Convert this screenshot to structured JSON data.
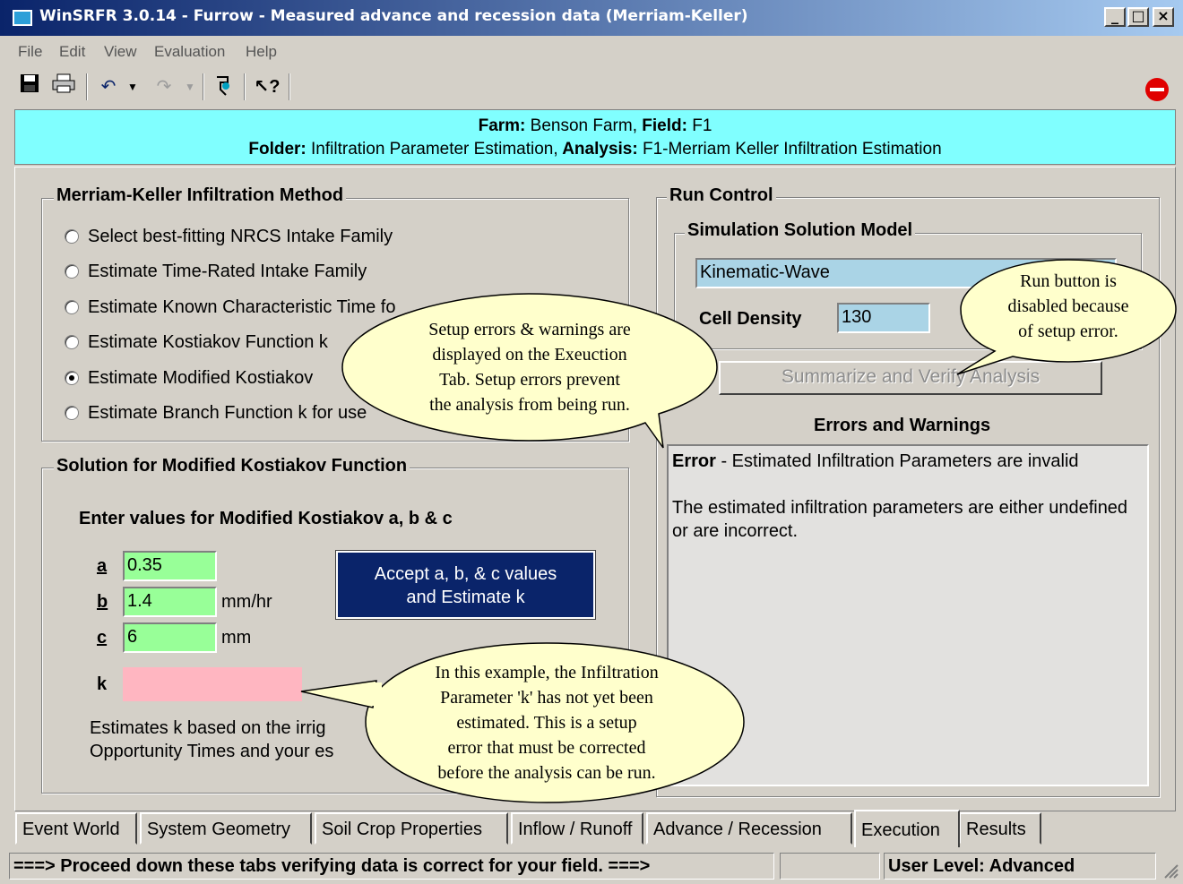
{
  "window": {
    "title": "WinSRFR 3.0.14 - Furrow - Measured advance and recession data (Merriam-Keller)",
    "min_label": "_",
    "max_label": "□",
    "close_label": "×"
  },
  "menu": [
    "File",
    "Edit",
    "View",
    "Evaluation",
    "Help"
  ],
  "toolbar": {
    "icons": [
      "save-icon",
      "print-icon",
      "undo-icon",
      "redo-icon",
      "tape-icon",
      "whats-this-icon",
      "stop-icon"
    ]
  },
  "header": {
    "farm_label": "Farm:",
    "farm_value": " Benson Farm,",
    "field_label": " Field:",
    "field_value": " F1",
    "folder_label": "Folder:",
    "folder_value": " Infiltration Parameter Estimation,",
    "analysis_label": " Analysis:",
    "analysis_value": " F1-Merriam Keller Infiltration Estimation"
  },
  "method": {
    "title": "Merriam-Keller Infiltration Method",
    "options": [
      "Select best-fitting NRCS Intake Family",
      "Estimate Time-Rated Intake Family",
      "Estimate Known Characteristic Time fo",
      "Estimate Kostiakov Function k",
      "Estimate Modified Kostiakov",
      "Estimate Branch Function k for use"
    ],
    "selected_index": 4
  },
  "solution": {
    "title": "Solution for Modified Kostiakov Function",
    "prompt": "Enter values for Modified Kostiakov a, b & c",
    "a_label": "a",
    "a_value": "0.35",
    "b_label": "b",
    "b_value": "1.4",
    "b_unit": "mm/hr",
    "c_label": "c",
    "c_value": "6",
    "c_unit": "mm",
    "k_label": "k",
    "k_value": "",
    "accept_line1": "Accept a, b, & c values",
    "accept_line2": "and Estimate k",
    "note_line1": "Estimates k based on the irrig",
    "note_line2": "Opportunity Times and your es"
  },
  "run_control": {
    "title": "Run Control",
    "model_title": "Simulation Solution Model",
    "model_value": "Kinematic-Wave",
    "cell_density_label": "Cell Density",
    "cell_density_value": "130",
    "summarize_button": "Summarize and Verify Analysis",
    "errors_title": "Errors and Warnings",
    "error_prefix": "Error",
    "error_text": " - Estimated Infiltration Parameters are invalid",
    "error_detail": "The estimated infiltration parameters are either undefined or are incorrect."
  },
  "callouts": {
    "setup": [
      "Setup errors & warnings are",
      "displayed on the Exeuction",
      "Tab.  Setup errors prevent",
      "the analysis from being run."
    ],
    "run": [
      "Run button is",
      "disabled because",
      "of setup error."
    ],
    "k": [
      "In this example, the Infiltration",
      "Parameter 'k' has not yet been",
      "estimated.  This is a setup",
      "error that must be corrected",
      "before the analysis can be run."
    ]
  },
  "tabs": [
    "Event World",
    "System Geometry",
    "Soil Crop Properties",
    "Inflow / Runoff",
    "Advance / Recession",
    "Execution",
    "Results"
  ],
  "active_tab": "Execution",
  "status": {
    "message": "===> Proceed down these tabs verifying data is correct for your field. ===>",
    "empty": "",
    "user_level": "User Level:  Advanced"
  },
  "colors": {
    "header_bg": "#80ffff",
    "input_green": "#98ff98",
    "k_pink": "#ffb6c1",
    "model_blue": "#aad4e6",
    "accept_bg": "#0a246a"
  }
}
